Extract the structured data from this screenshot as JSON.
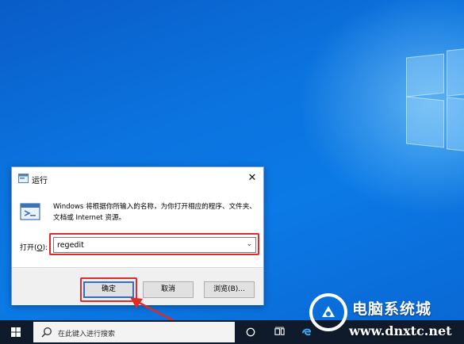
{
  "colors": {
    "highlight_red": "#e02a2a",
    "ok_border": "#2b6fd6",
    "desktop_blue": "#0b73de",
    "taskbar": "#0f1b2b"
  },
  "dialog": {
    "title": "运行",
    "description": "Windows 将根据你所输入的名称，为你打开相应的程序、文件夹、文档或 Internet 资源。",
    "open_label": "打开(O):",
    "open_label_pre": "打开(",
    "open_label_key": "O",
    "open_label_post": "):",
    "input_value": "regedit",
    "buttons": {
      "ok": "确定",
      "cancel": "取消",
      "browse": "浏览(B)..."
    },
    "close_glyph": "✕",
    "dropdown_glyph": "⌄"
  },
  "taskbar": {
    "search_placeholder": "在此键入进行搜索",
    "icons": [
      "windows-start-icon",
      "search-icon",
      "cortana-icon",
      "task-view-icon",
      "edge-icon"
    ]
  },
  "watermark": {
    "title": "电脑系统城",
    "url": "www.dnxtc.net"
  }
}
